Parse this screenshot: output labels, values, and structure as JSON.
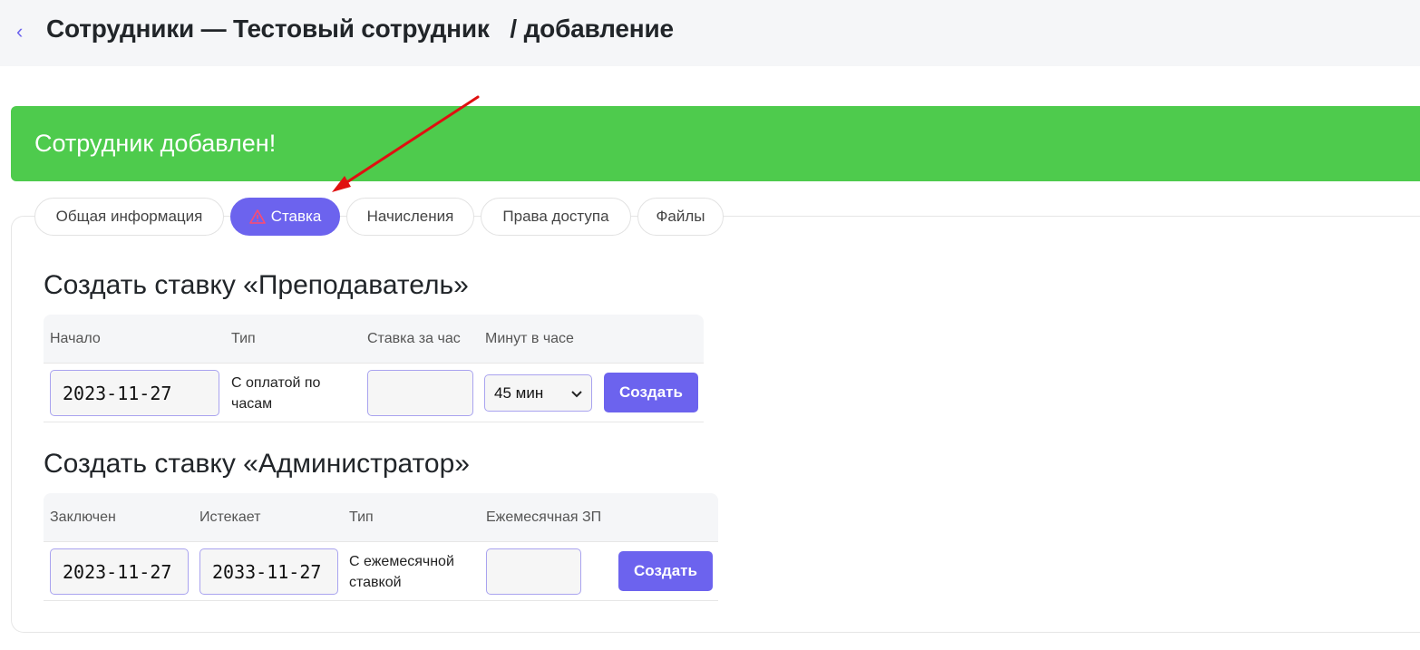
{
  "header": {
    "title": "Сотрудники — Тестовый сотрудник   / добавление"
  },
  "alert": {
    "message": "Сотрудник добавлен!"
  },
  "tabs": [
    {
      "label": "Общая информация",
      "active": false
    },
    {
      "label": "Ставка",
      "active": true,
      "icon": "warning-icon"
    },
    {
      "label": "Начисления",
      "active": false
    },
    {
      "label": "Права доступа",
      "active": false
    },
    {
      "label": "Файлы",
      "active": false
    }
  ],
  "teacher": {
    "title": "Создать ставку «Преподаватель»",
    "headers": [
      "Начало",
      "Тип",
      "Ставка за час",
      "Минут в часе"
    ],
    "start_value": "2023-11-27",
    "type_text": "С оплатой по часам",
    "rate_value": "",
    "minutes_option": "45 мин",
    "create_label": "Создать"
  },
  "admin": {
    "title": "Создать ставку «Администратор»",
    "headers": [
      "Заключен",
      "Истекает",
      "Тип",
      "Ежемесячная ЗП"
    ],
    "start_value": "2023-11-27",
    "end_value": "2033-11-27",
    "type_text": "С ежемесячной ставкой",
    "salary_value": "",
    "create_label": "Создать"
  },
  "colors": {
    "accent": "#6c63ee",
    "success": "#4ecb4d",
    "annotation_arrow": "#e01010"
  }
}
